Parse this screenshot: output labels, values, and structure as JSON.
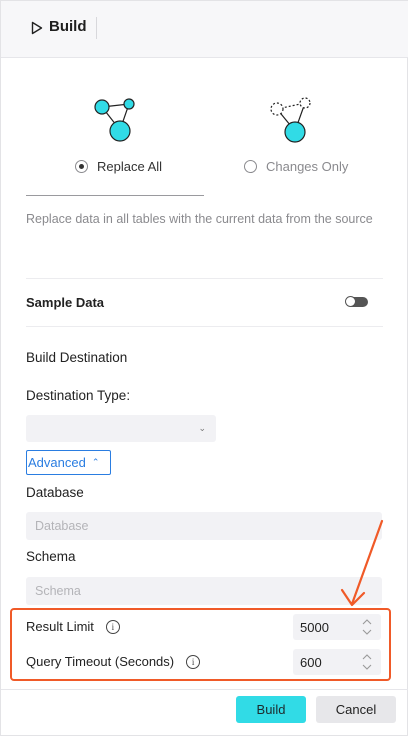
{
  "header": {
    "title": "Build",
    "play_icon": "play-icon"
  },
  "modes": [
    {
      "label": "Replace All",
      "selected": true,
      "icon": "nodes-solid-icon"
    },
    {
      "label": "Changes Only",
      "selected": false,
      "icon": "nodes-dashed-icon"
    }
  ],
  "description": "Replace data in all tables with the current data from the source",
  "sample_data": {
    "label": "Sample Data",
    "enabled": false
  },
  "build_destination": {
    "heading": "Build Destination",
    "destination_type_label": "Destination Type:",
    "destination_type_value": ""
  },
  "advanced": {
    "label": "Advanced",
    "expanded": true
  },
  "database": {
    "label": "Database",
    "placeholder": "Database",
    "value": ""
  },
  "schema": {
    "label": "Schema",
    "placeholder": "Schema",
    "value": ""
  },
  "result_limit": {
    "label": "Result Limit",
    "value": "5000"
  },
  "query_timeout": {
    "label": "Query Timeout (Seconds)",
    "value": "600"
  },
  "footer": {
    "build_label": "Build",
    "cancel_label": "Cancel"
  },
  "colors": {
    "accent_cyan": "#31dbe6",
    "link_blue": "#2a7de1",
    "highlight_orange": "#f05a28"
  }
}
